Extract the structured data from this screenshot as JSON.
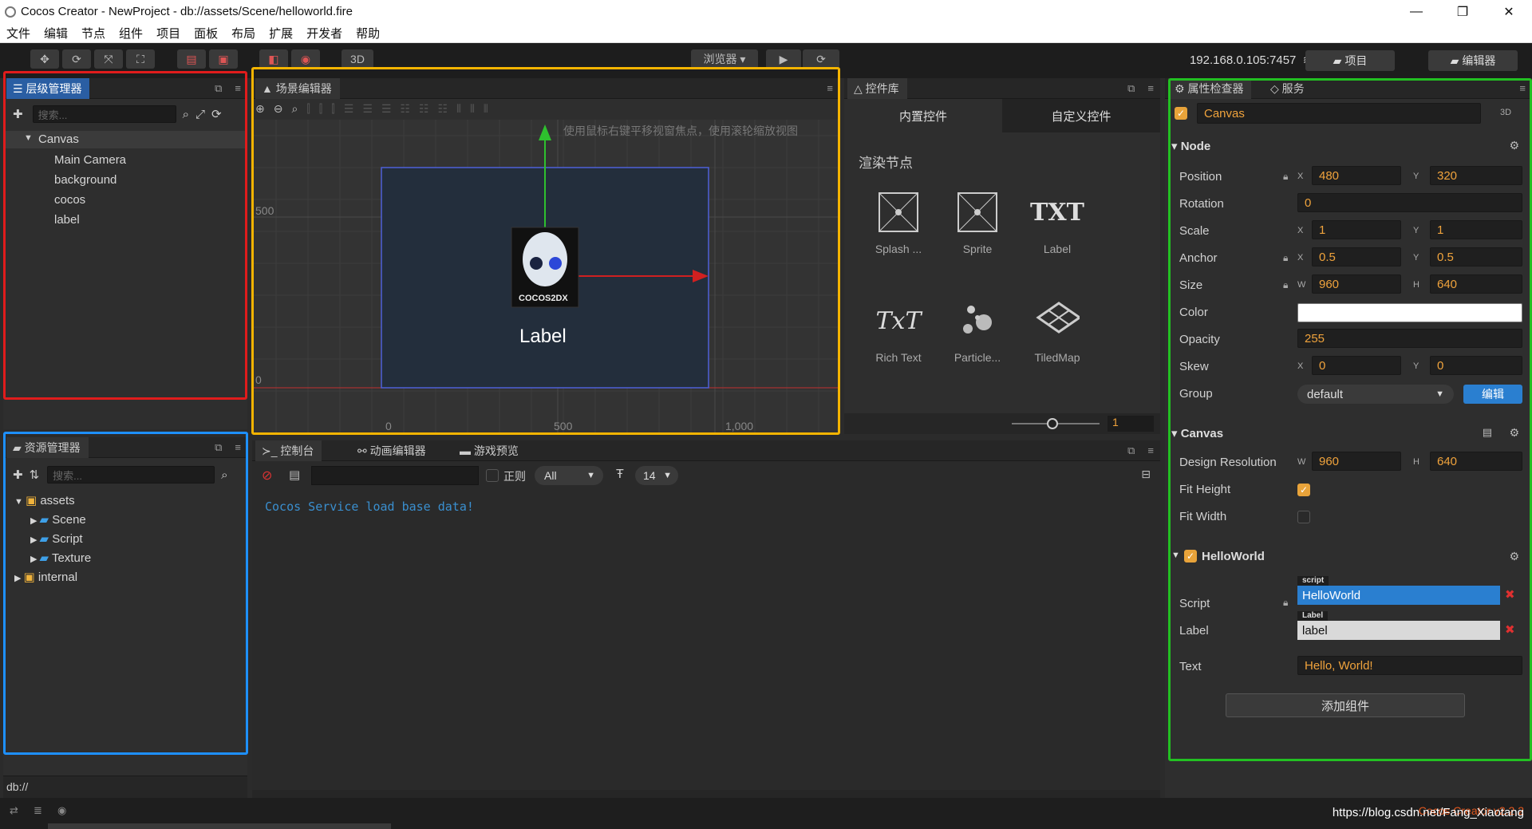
{
  "window": {
    "title": "Cocos Creator - NewProject - db://assets/Scene/helloworld.fire",
    "minimize": "—",
    "maximize": "❐",
    "close": "✕"
  },
  "menu": [
    "文件",
    "编辑",
    "节点",
    "组件",
    "项目",
    "面板",
    "布局",
    "扩展",
    "开发者",
    "帮助"
  ],
  "toolbar": {
    "mode_3d": "3D",
    "browser_label": "浏览器 ▾",
    "play_icon": "play-icon",
    "refresh_icon": "refresh-icon",
    "ip_address": "192.168.0.105:7457",
    "connections": "0",
    "project_button": "项目",
    "editor_button": "编辑器"
  },
  "hierarchy": {
    "title": "层级管理器",
    "search_placeholder": "搜索...",
    "root": "Canvas",
    "children": [
      "Main Camera",
      "background",
      "cocos",
      "label"
    ]
  },
  "scene": {
    "title": "场景编辑器",
    "hint": "使用鼠标右键平移视窗焦点，使用滚轮缩放视图",
    "y_ticks": [
      "500",
      "0"
    ],
    "x_ticks": [
      "0",
      "500",
      "1,000"
    ],
    "logo_text": "COCOS2DX",
    "label_text": "Label"
  },
  "widgets": {
    "title": "控件库",
    "tab_builtin": "内置控件",
    "tab_custom": "自定义控件",
    "section": "渲染节点",
    "items": [
      {
        "label": "Splash ...",
        "icon": "splash-icon"
      },
      {
        "label": "Sprite",
        "icon": "sprite-icon"
      },
      {
        "label": "Label",
        "icon": "txt-icon",
        "glyph": "TXT"
      },
      {
        "label": "Rich Text",
        "icon": "richtext-icon",
        "glyph": "TxT"
      },
      {
        "label": "Particle...",
        "icon": "particle-icon"
      },
      {
        "label": "TiledMap",
        "icon": "tiledmap-icon"
      }
    ],
    "zoom_value": "1"
  },
  "assets": {
    "title": "资源管理器",
    "search_placeholder": "搜索...",
    "tree": [
      {
        "label": "assets"
      },
      {
        "label": "Scene"
      },
      {
        "label": "Script"
      },
      {
        "label": "Texture"
      },
      {
        "label": "internal"
      }
    ],
    "footer": "db://"
  },
  "console": {
    "tab_console": "控制台",
    "tab_animation": "动画编辑器",
    "tab_preview": "游戏预览",
    "regex_label": "正则",
    "filter_value": "All",
    "font_size": "14",
    "log_line": "Cocos Service load base data!"
  },
  "inspector": {
    "tab_inspector": "属性检查器",
    "tab_service": "服务",
    "node_name": "Canvas",
    "mode_3d": "3D",
    "node_section": "Node",
    "position": {
      "label": "Position",
      "x": "480",
      "y": "320"
    },
    "rotation": {
      "label": "Rotation",
      "value": "0"
    },
    "scale": {
      "label": "Scale",
      "x": "1",
      "y": "1"
    },
    "anchor": {
      "label": "Anchor",
      "x": "0.5",
      "y": "0.5"
    },
    "size": {
      "label": "Size",
      "w": "960",
      "h": "640"
    },
    "color": {
      "label": "Color",
      "value": "#ffffff"
    },
    "opacity": {
      "label": "Opacity",
      "value": "255"
    },
    "skew": {
      "label": "Skew",
      "x": "0",
      "y": "0"
    },
    "group": {
      "label": "Group",
      "value": "default",
      "edit_button": "编辑"
    },
    "canvas_section": "Canvas",
    "design_resolution": {
      "label": "Design Resolution",
      "w": "960",
      "h": "640"
    },
    "fit_height": {
      "label": "Fit Height",
      "checked": true
    },
    "fit_width": {
      "label": "Fit Width",
      "checked": false
    },
    "helloworld_section": "HelloWorld",
    "script": {
      "label": "Script",
      "tag": "script",
      "value": "HelloWorld"
    },
    "label_prop": {
      "label": "Label",
      "tag": "Label",
      "value": "label"
    },
    "text": {
      "label": "Text",
      "value": "Hello, World!"
    },
    "add_component": "添加组件"
  },
  "statusbar": {
    "version": "Cocos Creator v2.2.2",
    "watermark": "https://blog.csdn.net/Fang_Xiaotang"
  },
  "colors": {
    "accent_blue": "#2a5ea3",
    "value_orange": "#f0a33c",
    "outline_red": "#e01c1c",
    "outline_yellow": "#f5b400",
    "outline_blue": "#1e90ff",
    "outline_green": "#22c022"
  }
}
